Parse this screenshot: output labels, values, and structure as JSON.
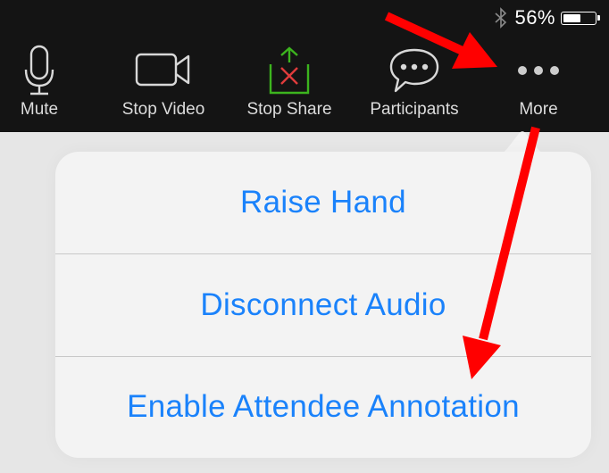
{
  "status_bar": {
    "bluetooth_icon": "bluetooth-icon",
    "battery_percent_label": "56%",
    "battery_level": 0.56
  },
  "toolbar": {
    "items": [
      {
        "label": "Mute",
        "icon": "microphone-icon"
      },
      {
        "label": "Stop Video",
        "icon": "video-camera-icon"
      },
      {
        "label": "Stop Share",
        "icon": "stop-share-icon"
      },
      {
        "label": "Participants",
        "icon": "chat-bubble-icon"
      },
      {
        "label": "More",
        "icon": "more-dots-icon"
      }
    ]
  },
  "more_menu": {
    "items": [
      {
        "label": "Raise Hand"
      },
      {
        "label": "Disconnect Audio"
      },
      {
        "label": "Enable Attendee Annotation"
      }
    ]
  },
  "colors": {
    "toolbar_bg": "#141414",
    "menu_text": "#1a82fb",
    "annotation_arrow": "#ff0000",
    "share_green": "#3cb41e",
    "share_red": "#e03c3c"
  }
}
